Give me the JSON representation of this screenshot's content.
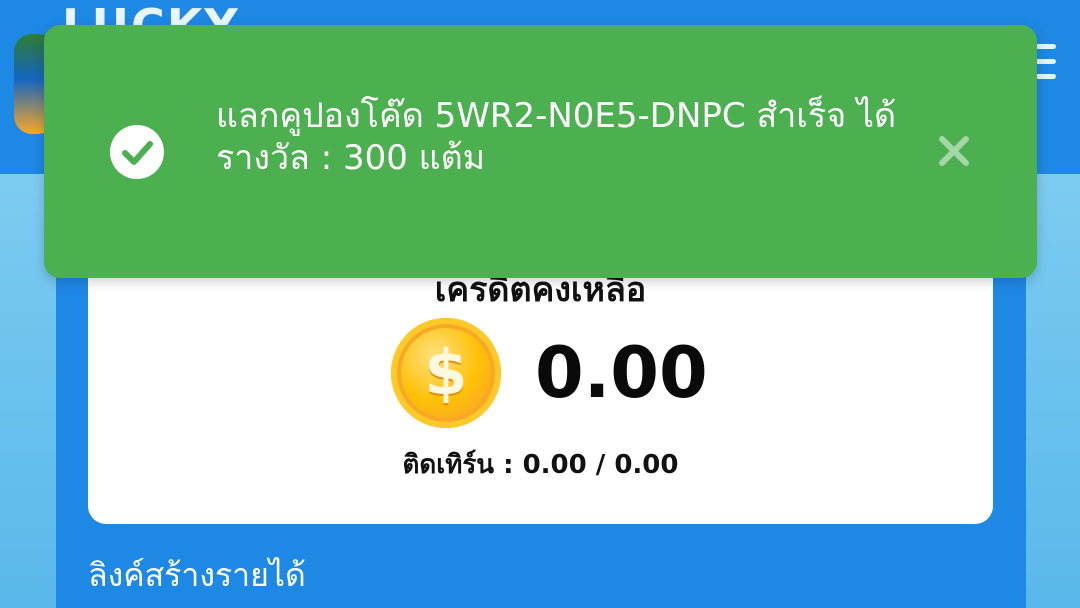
{
  "header": {
    "logo_text": "LUCKY"
  },
  "toast": {
    "message_line1": "แลกคูปองโค๊ด 5WR2-N0E5-DNPC สำเร็จ ได้",
    "message_line2": "รางวัล : 300 แต้ม",
    "icon": "check-circle-icon",
    "close_icon": "close-icon",
    "color": "#4caf50"
  },
  "credit": {
    "title": "เครดิตคงเหลือ",
    "amount": "0.00",
    "coin_icon": "coin-dollar-icon",
    "turnover_label": "ติดเทิร์น : 0.00 / 0.00"
  },
  "sections": {
    "income_link_heading": "ลิงค์สร้างรายได้"
  },
  "colors": {
    "primary_blue": "#1e88e5",
    "card_bg": "#ffffff",
    "success_green": "#4caf50"
  }
}
